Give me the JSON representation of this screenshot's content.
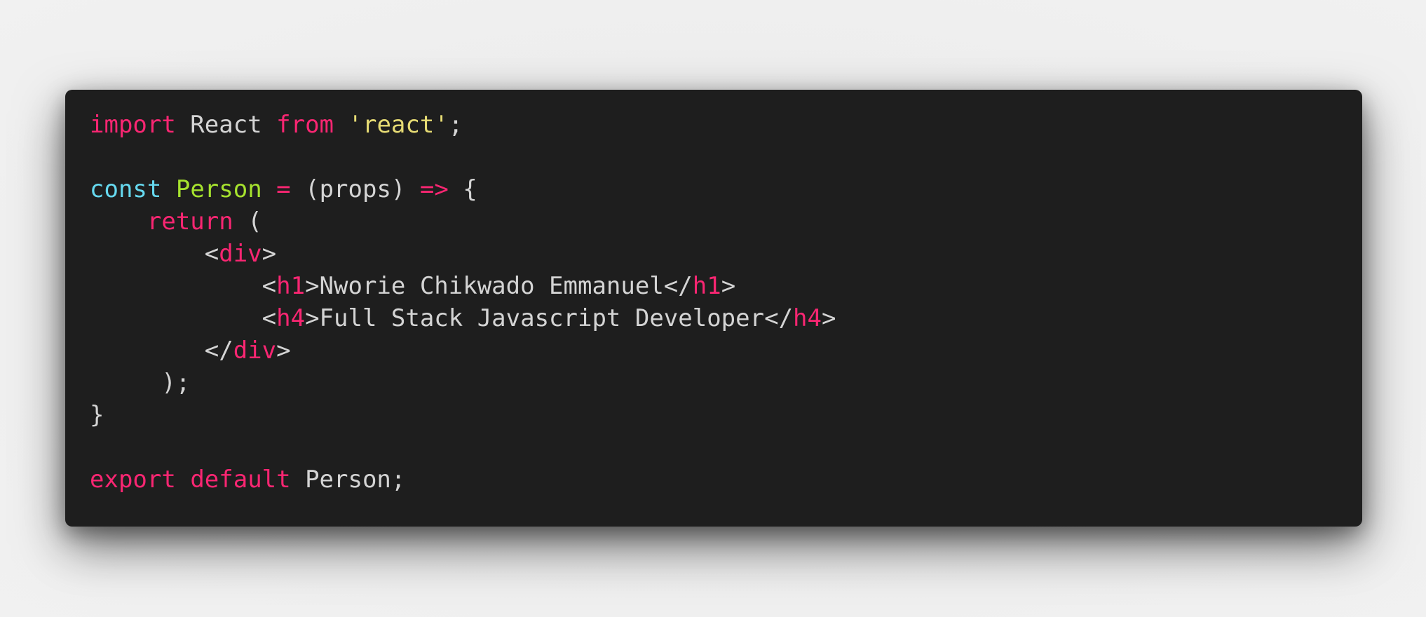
{
  "colors": {
    "page_background": "#eeeeee",
    "editor_background": "#1e1e1e",
    "plain": "#d4d4d4",
    "keyword": "#f92672",
    "storage": "#66d9ef",
    "entity": "#a6e22e",
    "string": "#e6db74"
  },
  "code": {
    "language": "javascript",
    "lines": [
      {
        "tokens": [
          {
            "type": "keyword",
            "text": "import"
          },
          {
            "type": "plain",
            "text": " React "
          },
          {
            "type": "keyword",
            "text": "from"
          },
          {
            "type": "plain",
            "text": " "
          },
          {
            "type": "string",
            "text": "'react'"
          },
          {
            "type": "plain",
            "text": ";"
          }
        ]
      },
      {
        "tokens": []
      },
      {
        "tokens": [
          {
            "type": "storage",
            "text": "const"
          },
          {
            "type": "plain",
            "text": " "
          },
          {
            "type": "entity",
            "text": "Person"
          },
          {
            "type": "plain",
            "text": " "
          },
          {
            "type": "keyword",
            "text": "="
          },
          {
            "type": "plain",
            "text": " (props) "
          },
          {
            "type": "keyword",
            "text": "=>"
          },
          {
            "type": "plain",
            "text": " {"
          }
        ]
      },
      {
        "tokens": [
          {
            "type": "plain",
            "text": "    "
          },
          {
            "type": "keyword",
            "text": "return"
          },
          {
            "type": "plain",
            "text": " ("
          }
        ]
      },
      {
        "tokens": [
          {
            "type": "plain",
            "text": "        <"
          },
          {
            "type": "keyword",
            "text": "div"
          },
          {
            "type": "plain",
            "text": ">"
          }
        ]
      },
      {
        "tokens": [
          {
            "type": "plain",
            "text": "            <"
          },
          {
            "type": "keyword",
            "text": "h1"
          },
          {
            "type": "plain",
            "text": ">Nworie Chikwado Emmanuel</"
          },
          {
            "type": "keyword",
            "text": "h1"
          },
          {
            "type": "plain",
            "text": ">"
          }
        ]
      },
      {
        "tokens": [
          {
            "type": "plain",
            "text": "            <"
          },
          {
            "type": "keyword",
            "text": "h4"
          },
          {
            "type": "plain",
            "text": ">Full Stack Javascript Developer</"
          },
          {
            "type": "keyword",
            "text": "h4"
          },
          {
            "type": "plain",
            "text": ">"
          }
        ]
      },
      {
        "tokens": [
          {
            "type": "plain",
            "text": "        </"
          },
          {
            "type": "keyword",
            "text": "div"
          },
          {
            "type": "plain",
            "text": ">"
          }
        ]
      },
      {
        "tokens": [
          {
            "type": "plain",
            "text": "     );"
          }
        ]
      },
      {
        "tokens": [
          {
            "type": "plain",
            "text": "}"
          }
        ]
      },
      {
        "tokens": []
      },
      {
        "tokens": [
          {
            "type": "keyword",
            "text": "export"
          },
          {
            "type": "plain",
            "text": " "
          },
          {
            "type": "keyword",
            "text": "default"
          },
          {
            "type": "plain",
            "text": " Person;"
          }
        ]
      }
    ]
  }
}
